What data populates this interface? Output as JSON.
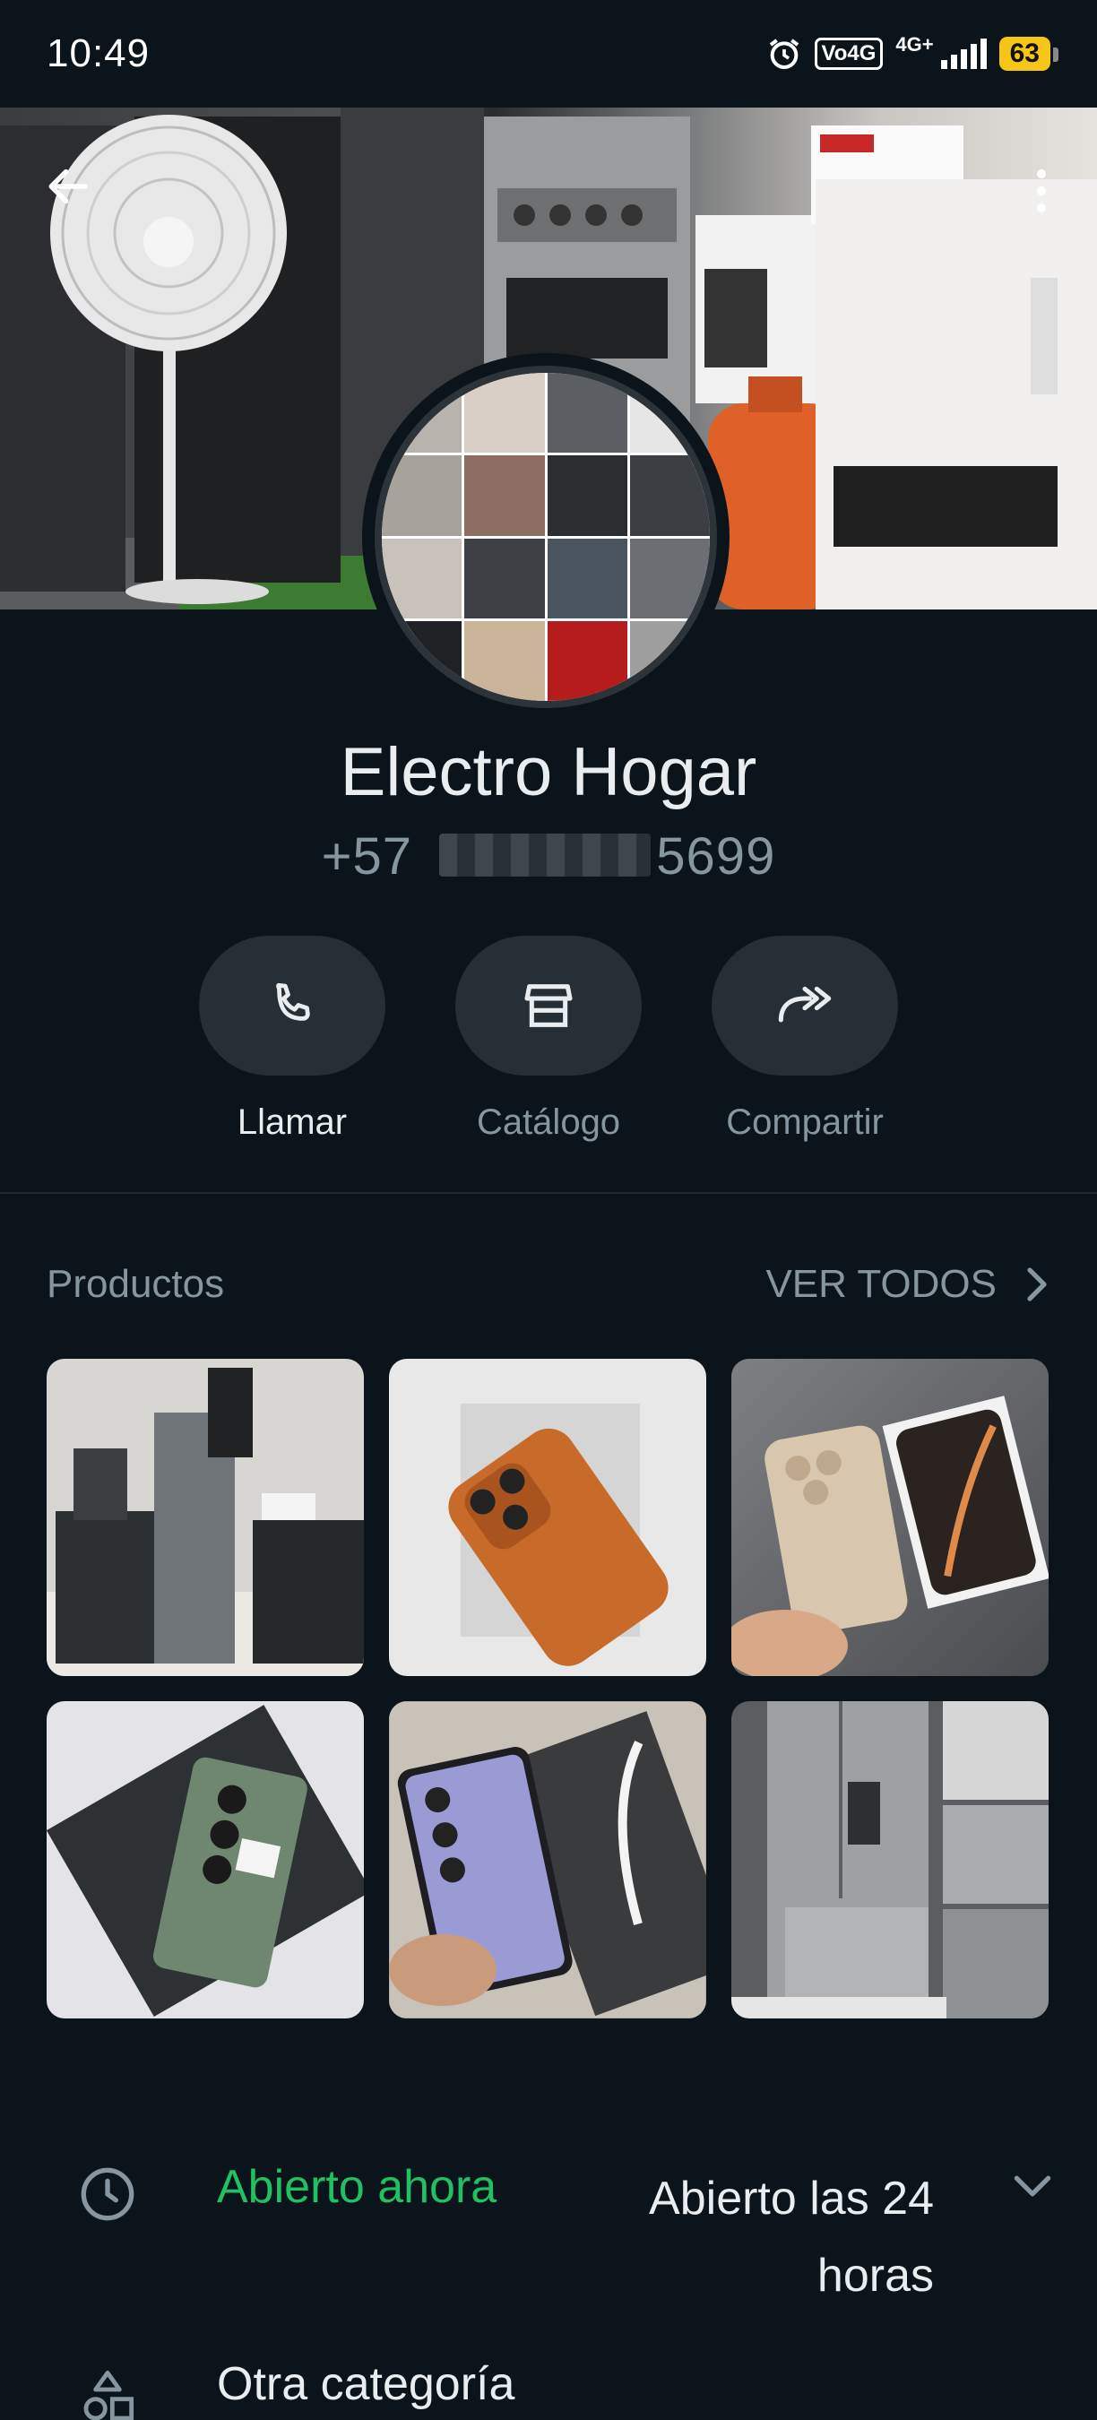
{
  "status_bar": {
    "time": "10:49",
    "volte": "Vo4G",
    "network": "4G+",
    "battery": "63"
  },
  "profile": {
    "name": "Electro Hogar",
    "phone_prefix": "+57",
    "phone_suffix": "5699"
  },
  "actions": [
    {
      "label": "Llamar",
      "icon": "phone-icon"
    },
    {
      "label": "Catálogo",
      "icon": "store-icon"
    },
    {
      "label": "Compartir",
      "icon": "share-icon"
    }
  ],
  "products": {
    "title": "Productos",
    "view_all": "VER TODOS"
  },
  "hours": {
    "status": "Abierto ahora",
    "schedule": "Abierto las 24 horas"
  },
  "category": {
    "label": "Otra categoría"
  },
  "colors": {
    "background": "#0b141a",
    "accent_green": "#21c063",
    "button_bg": "#262f35",
    "muted_text": "#8696a0"
  }
}
